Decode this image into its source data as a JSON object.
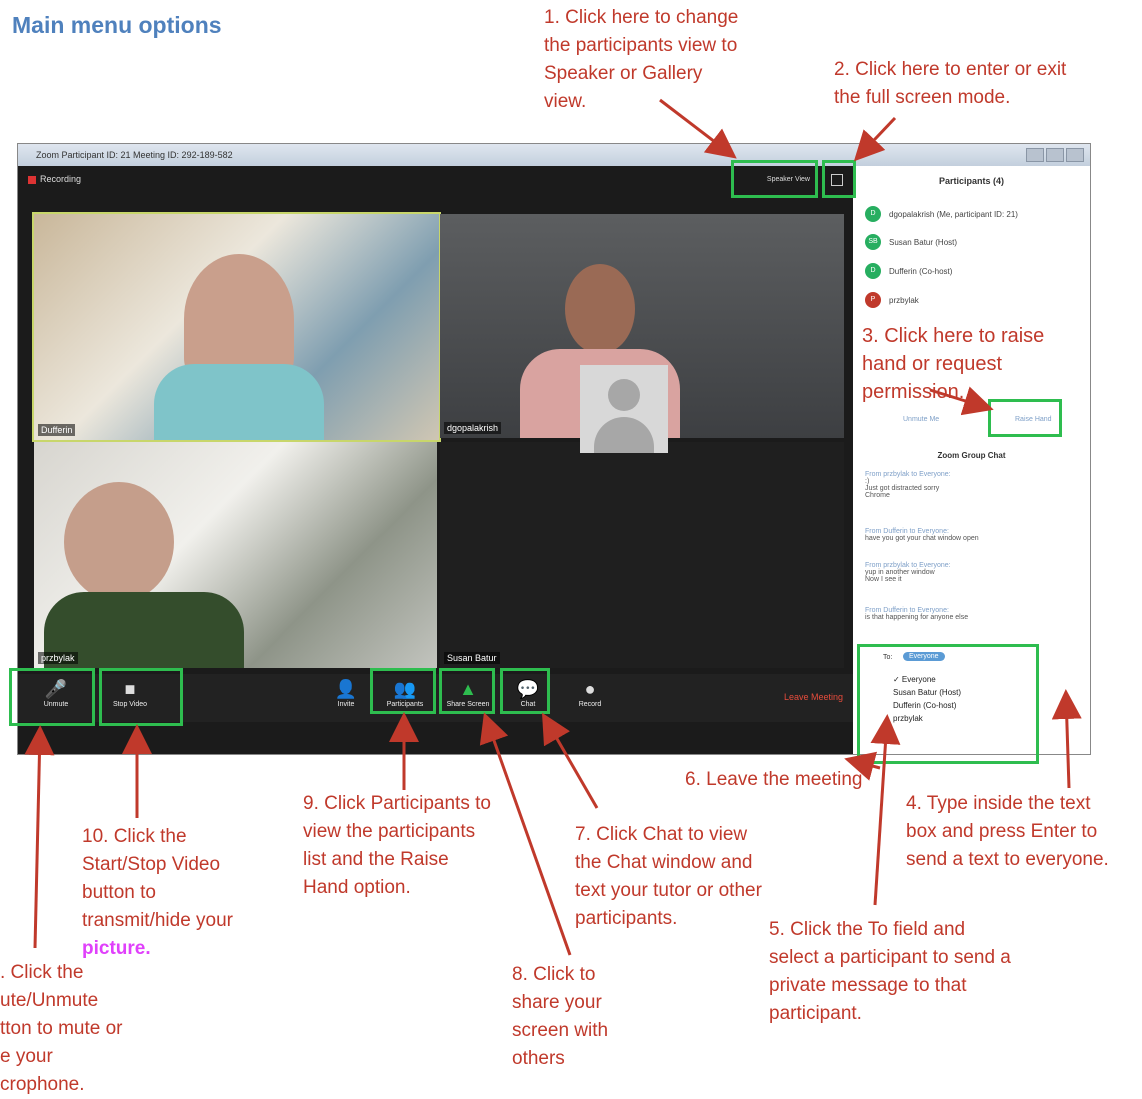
{
  "heading": "Main menu options",
  "window": {
    "title": "Zoom Participant ID: 21   Meeting ID: 292-189-582",
    "recording": "Recording",
    "speaker_view": "Speaker View",
    "tiles": [
      "Dufferin",
      "dgopalakrish",
      "przbylak",
      "Susan Batur"
    ],
    "toolbar": {
      "mute": "Unmute",
      "video": "Stop Video",
      "invite": "Invite",
      "participants": "Participants",
      "share": "Share Screen",
      "chat": "Chat",
      "record": "Record",
      "leave": "Leave Meeting"
    },
    "panel": {
      "participants_title": "Participants (4)",
      "participants": [
        {
          "initial": "D",
          "name": "dgopalakrish (Me, participant ID: 21)",
          "color": "#27ae60"
        },
        {
          "initial": "SB",
          "name": "Susan Batur (Host)",
          "color": "#27ae60"
        },
        {
          "initial": "D",
          "name": "Dufferin (Co-host)",
          "color": "#27ae60"
        },
        {
          "initial": "P",
          "name": "przbylak",
          "color": "#c0392b"
        }
      ],
      "unmute_me": "Unmute Me",
      "raise_hand": "Raise Hand",
      "chat_title": "Zoom Group Chat",
      "messages": [
        {
          "from": "From przbylak to Everyone:",
          "text": ":)\nJust got distracted sorry\nChrome"
        },
        {
          "from": "From Dufferin to Everyone:",
          "text": "have you got your chat window open"
        },
        {
          "from": "From przbylak to Everyone:",
          "text": "yup in another window\nNow I see it"
        },
        {
          "from": "From Dufferin to Everyone:",
          "text": "is that happening for anyone else"
        }
      ],
      "to_label": "To:",
      "to_value": "Everyone",
      "dropdown": [
        "✓ Everyone",
        "Susan Batur (Host)",
        "Dufferin (Co-host)",
        "przbylak"
      ]
    }
  },
  "annotations": {
    "a1": "1. Click here to change\nthe participants view to\nSpeaker or Gallery\nview.",
    "a2": "2. Click here to enter or exit\nthe full screen mode.",
    "a3": "3. Click here to raise\nhand or request\npermission.",
    "a4": "4. Type inside the text\nbox and press Enter to\nsend a text to everyone.",
    "a5": "5. Click the To field and\nselect a participant to send a\nprivate message to that\nparticipant.",
    "a6": "6. Leave the meeting",
    "a7": "7. Click Chat to view\nthe Chat window and\ntext your tutor or other\nparticipants.",
    "a8": "8. Click to\nshare your\nscreen with\nothers",
    "a9": "9. Click Participants to\nview the participants\nlist and the Raise\nHand option.",
    "a10": "10. Click the\nStart/Stop Video\nbutton to\ntransmit/hide your",
    "a10_end": "picture.",
    "a11": ". Click the\nute/Unmute\ntton to mute or\ne your\ncrophone."
  }
}
